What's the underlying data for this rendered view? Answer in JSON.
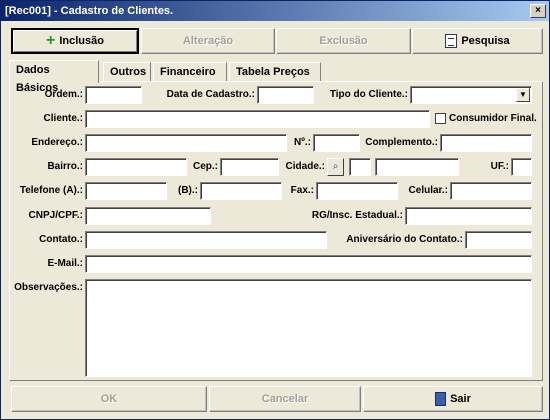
{
  "window": {
    "title": "[Rec001] - Cadastro de Clientes.",
    "close_glyph": "×"
  },
  "toolbar": {
    "inclusao": "Inclusão",
    "alteracao": "Alteração",
    "exclusao": "Exclusão",
    "pesquisa": "Pesquisa"
  },
  "tabs": [
    "Dados Básicos",
    "Outros",
    "Financeiro",
    "Tabela Preços"
  ],
  "form": {
    "ordem": "Ordem.:",
    "data_cadastro": "Data de Cadastro.:",
    "tipo_cliente": "Tipo do Cliente.:",
    "cliente": "Cliente.:",
    "consumidor_final": "Consumidor Final.",
    "endereco": "Endereço.:",
    "numero": "Nº.:",
    "complemento": "Complemento.:",
    "bairro": "Bairro.:",
    "cep": "Cep.:",
    "cidade": "Cidade.:",
    "uf": "UF.:",
    "telefone_a": "Telefone (A).:",
    "telefone_b": "(B).:",
    "fax": "Fax.:",
    "celular": "Celular.:",
    "cnpj": "CNPJ/CPF.:",
    "rg": "RG/Insc. Estadual.:",
    "contato": "Contato.:",
    "aniversario": "Aniversário do Contato.:",
    "email": "E-Mail.:",
    "observacoes": "Observações.:"
  },
  "values": {
    "ordem": "",
    "data_cadastro": "",
    "tipo_cliente": "",
    "cliente": "",
    "endereco": "",
    "numero": "",
    "complemento": "",
    "bairro": "",
    "cep": "",
    "cidade_code": "",
    "cidade_nome": "",
    "uf": "",
    "telefone_a": "",
    "telefone_b": "",
    "fax": "",
    "celular": "",
    "cnpj": "",
    "rg": "",
    "contato": "",
    "aniversario": "",
    "email": "",
    "observacoes": ""
  },
  "footer": {
    "ok": "OK",
    "cancelar": "Cancelar",
    "sair": "Sair"
  }
}
